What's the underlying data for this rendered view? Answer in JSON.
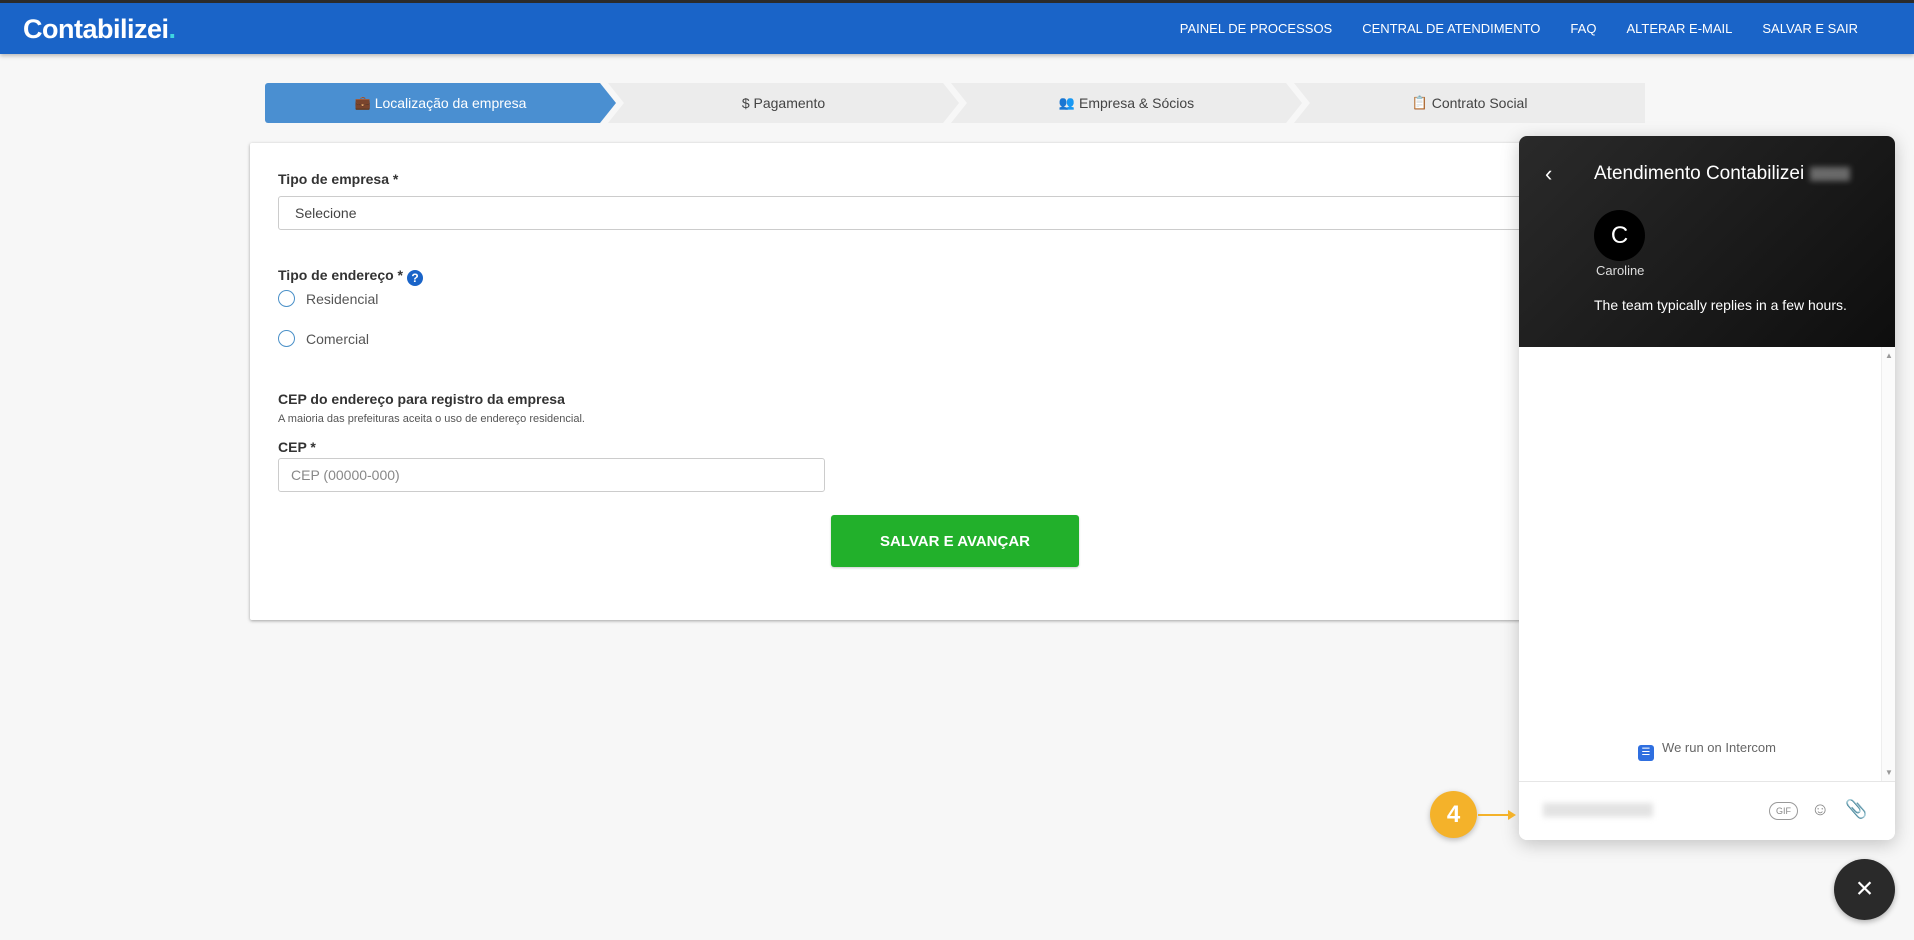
{
  "header": {
    "logo_text": "Contabilizei",
    "logo_dot": ".",
    "nav": [
      "PAINEL DE PROCESSOS",
      "CENTRAL DE ATENDIMENTO",
      "FAQ",
      "ALTERAR E-MAIL",
      "SALVAR E SAIR"
    ]
  },
  "steps": [
    {
      "icon": "briefcase-icon",
      "label": "Localização da empresa",
      "active": true
    },
    {
      "icon": "dollar-icon",
      "label": "$ Pagamento",
      "active": false
    },
    {
      "icon": "users-icon",
      "label": "Empresa & Sócios",
      "active": false
    },
    {
      "icon": "document-icon",
      "label": "Contrato Social",
      "active": false
    }
  ],
  "form": {
    "company_type_label": "Tipo de empresa *",
    "company_type_value": "Selecione",
    "address_type_label": "Tipo de endereço *",
    "radio_options": [
      "Residencial",
      "Comercial"
    ],
    "cep_section_title": "CEP do endereço para registro da empresa",
    "cep_section_note": "A maioria das prefeituras aceita o uso de endereço residencial.",
    "cep_label": "CEP *",
    "cep_placeholder": "CEP (00000-000)",
    "save_button": "SALVAR E AVANÇAR"
  },
  "chat": {
    "title": "Atendimento Contabilizei",
    "avatar_initial": "C",
    "agent_name": "Caroline",
    "reply_note": "The team typically replies in a few hours.",
    "powered_by": "We run on Intercom",
    "gif_label": "GIF"
  },
  "annotation": {
    "number": "4"
  },
  "colors": {
    "brand_blue": "#1a64c8",
    "step_active": "#4a8fd1",
    "save_green": "#22b02b",
    "badge": "#f4b22a"
  }
}
